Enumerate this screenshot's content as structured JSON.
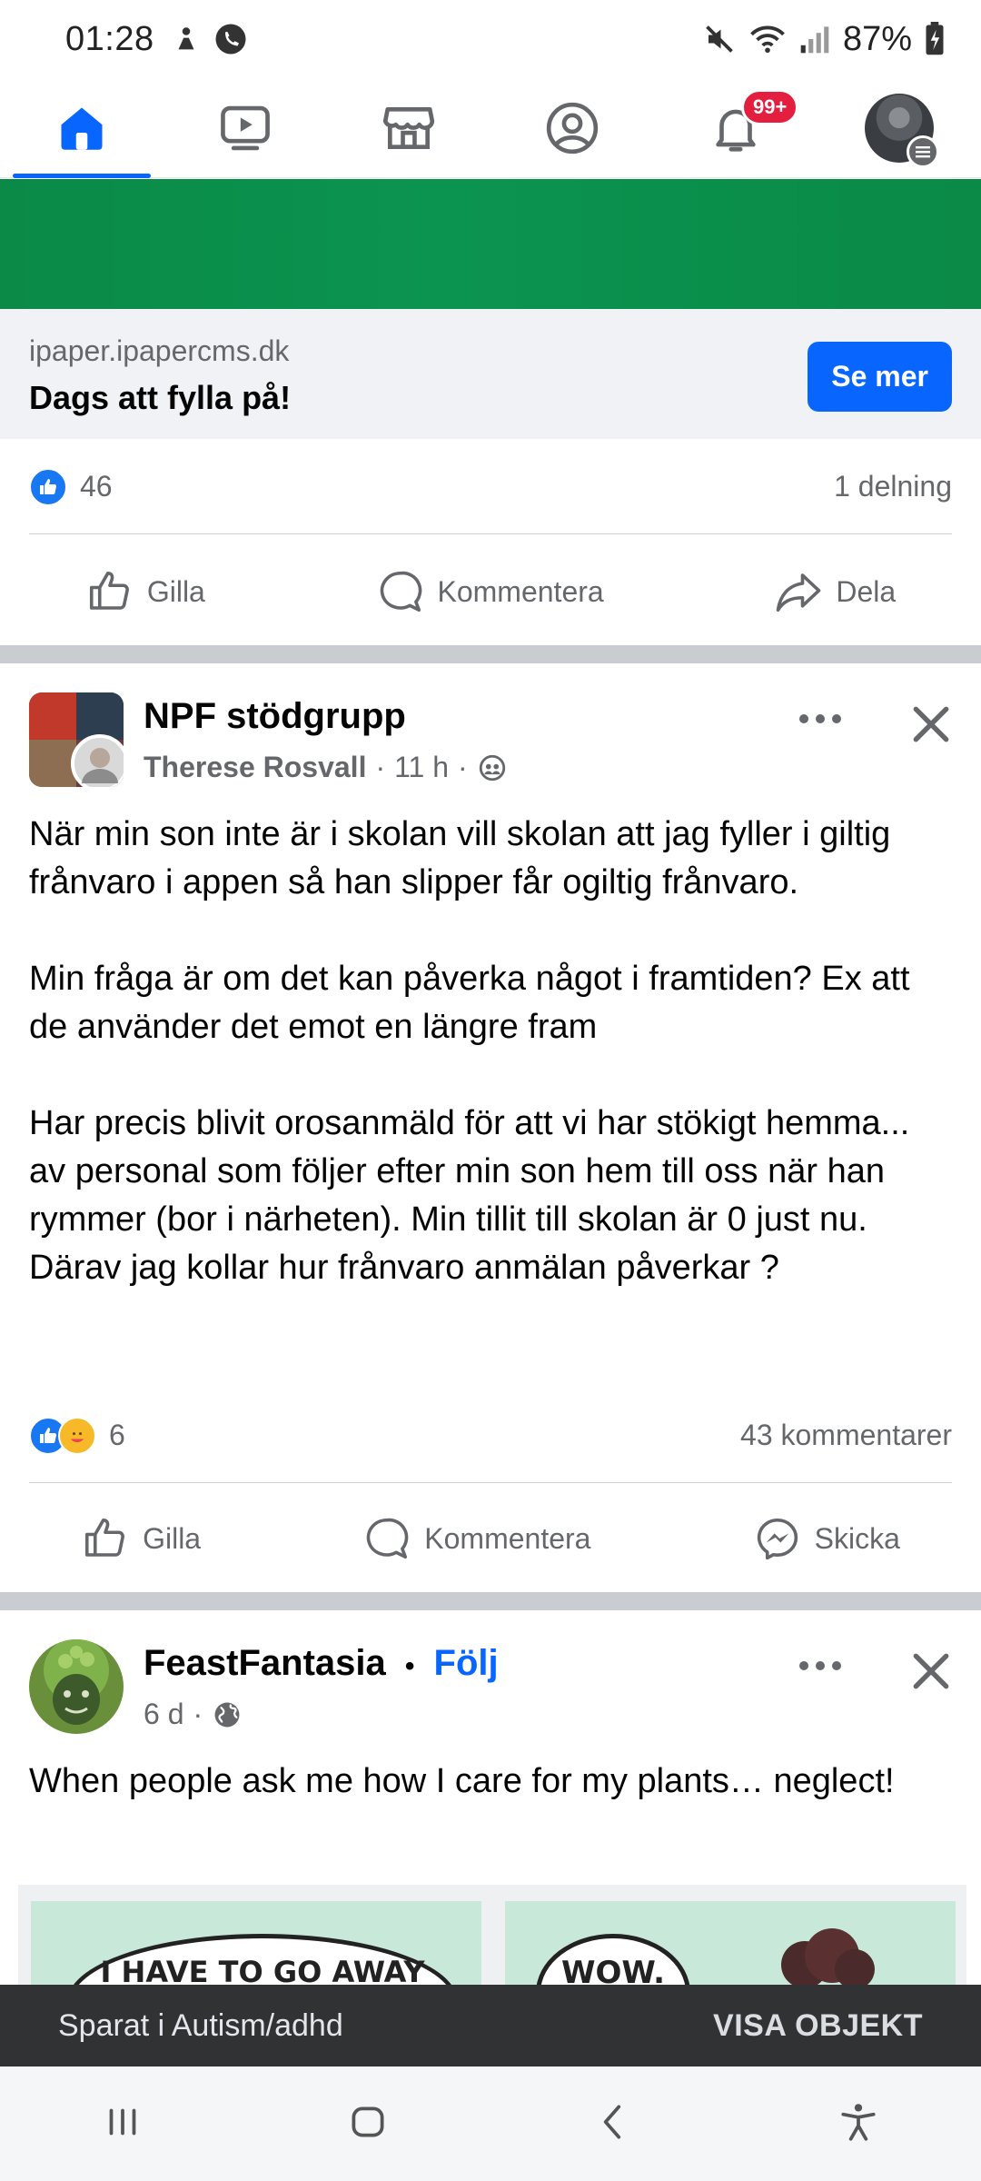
{
  "status_bar": {
    "time": "01:28",
    "battery": "87%"
  },
  "nav": {
    "notification_badge": "99+"
  },
  "ad": {
    "domain": "ipaper.ipapercms.dk",
    "title": "Dags att fylla på!",
    "cta": "Se mer",
    "likes": "46",
    "shares": "1 delning",
    "actions": [
      "Gilla",
      "Kommentera",
      "Dela"
    ]
  },
  "post1": {
    "group": "NPF stödgrupp",
    "author": "Therese Rosvall",
    "time": "11 h",
    "text": "När min son inte är i skolan vill skolan att jag fyller i giltig frånvaro i appen så han slipper får ogiltig frånvaro.\n\nMin fråga är om det kan påverka något i framtiden? Ex att de använder det emot en längre fram\n\nHar precis blivit orosanmäld för att vi har stökigt hemma... av personal som följer efter min son hem till oss när han rymmer (bor i närheten). Min tillit till skolan är 0 just nu.\nDärav jag kollar hur frånvaro anmälan påverkar ?",
    "reactions": "6",
    "comments": "43 kommentarer",
    "actions": [
      "Gilla",
      "Kommentera",
      "Skicka"
    ]
  },
  "post2": {
    "author": "FeastFantasia",
    "follow": "Följ",
    "time": "6 d",
    "text": "When people ask me how I care for my plants… neglect!",
    "comic_left": "I HAVE TO GO AWAY",
    "comic_right": "WOW."
  },
  "snackbar": {
    "message": "Sparat i Autism/adhd",
    "action": "VISA OBJEKT"
  },
  "colors": {
    "accent": "#0866ff",
    "ad_banner": "#0a8a46",
    "badge": "#e41e3f"
  }
}
